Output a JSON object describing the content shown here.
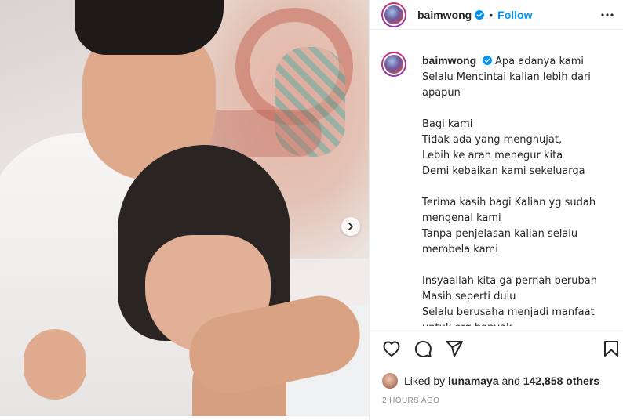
{
  "header": {
    "username": "baimwong",
    "follow_label": "Follow",
    "separator": "•"
  },
  "caption": {
    "username": "baimwong",
    "text": "Apa adanya kami\nSelalu Mencintai kalian lebih dari\napapun\n\nBagi kami\nTidak ada yang menghujat,\nLebih ke arah menegur kita\nDemi kebaikan kami sekeluarga\n\nTerima kasih bagi Kalian yg sudah\nmengenal kami\nTanpa penjelasan kalian selalu\nmembela kami\n\nInsyaallah kita ga pernah berubah\nMasih seperti dulu\nSelalu berusaha menjadi manfaat\nuntuk org banyak\nMaaf kalau kami masih banyak"
  },
  "likes": {
    "prefix": "Liked by",
    "user": "lunamaya",
    "conjunction": "and",
    "count": "142,858 others"
  },
  "timestamp": "2 HOURS AGO",
  "colors": {
    "accent": "#0095f6",
    "text": "#262626",
    "muted": "#8e8e8e"
  },
  "icons": [
    "verified-badge-icon",
    "more-options-icon",
    "heart-icon",
    "comment-icon",
    "share-icon",
    "bookmark-icon",
    "chevron-right-icon"
  ]
}
